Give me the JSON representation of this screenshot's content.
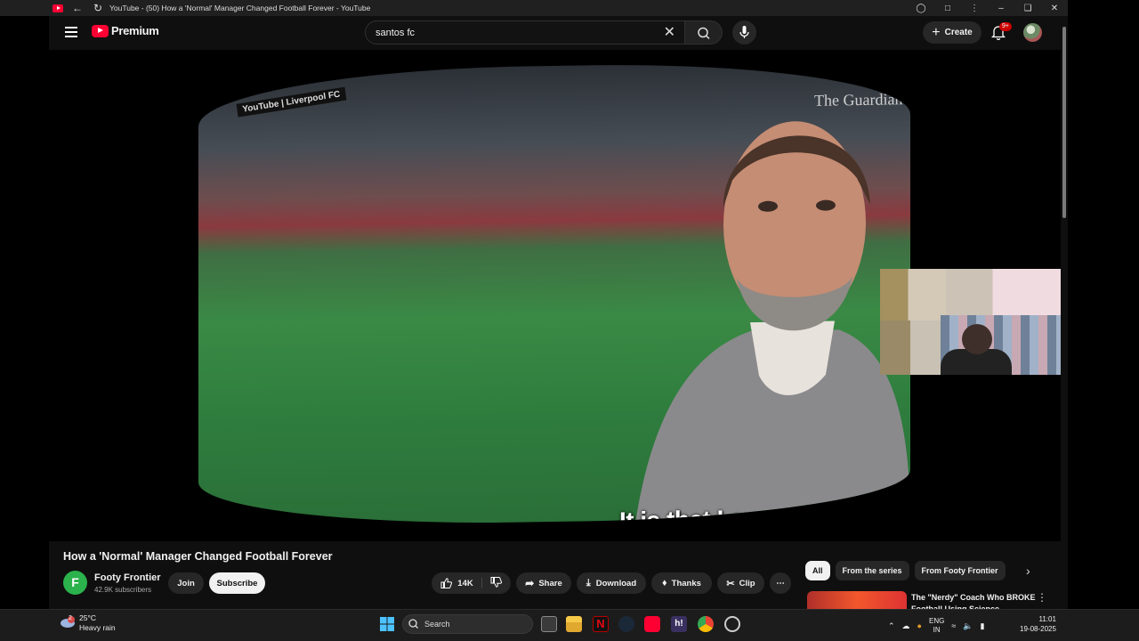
{
  "window": {
    "title": "YouTube - (50) How a 'Normal' Manager Changed Football Forever - YouTube"
  },
  "header": {
    "logo_text": "Premium",
    "search_value": "santos fc",
    "create_label": "Create",
    "notification_badge": "9+"
  },
  "video": {
    "watermark_left": "YouTube | Liverpool FC",
    "watermark_right": "The Guardian",
    "caption": "It is that I am"
  },
  "details": {
    "title": "How a 'Normal' Manager Changed Football Forever",
    "channel_name": "Footy Frontier",
    "channel_initial": "F",
    "subscribers": "42.9K subscribers",
    "join_label": "Join",
    "subscribe_label": "Subscribe",
    "like_count": "14K",
    "share_label": "Share",
    "download_label": "Download",
    "thanks_label": "Thanks",
    "clip_label": "Clip"
  },
  "chips": {
    "items": [
      "All",
      "From the series",
      "From Footy Frontier"
    ]
  },
  "recommendation": {
    "title": "The \"Nerdy\" Coach Who BROKE Football Using Science"
  },
  "taskbar": {
    "temperature": "25°C",
    "weather": "Heavy rain",
    "weather_badge": "2",
    "search_placeholder": "Search",
    "language": "ENG",
    "region": "IN",
    "time": "11:01",
    "date": "19-08-2025"
  },
  "colors": {
    "brand_red": "#ff0033",
    "background": "#0f0f0f",
    "chip_bg": "#272727"
  }
}
